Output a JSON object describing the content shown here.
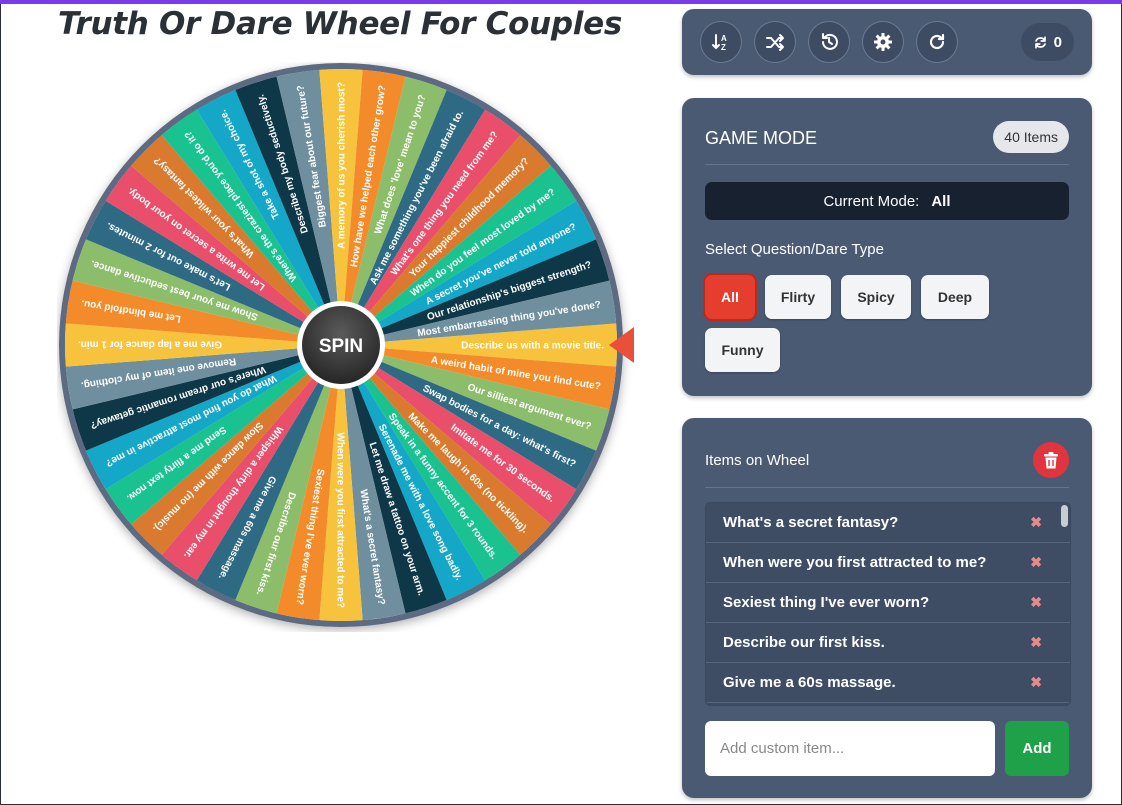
{
  "title": "Truth Or Dare Wheel For Couples",
  "spin_label": "SPIN",
  "toolbar": {
    "buttons": [
      {
        "icon": "sort-icon"
      },
      {
        "icon": "shuffle-icon"
      },
      {
        "icon": "history-icon"
      },
      {
        "icon": "settings-icon"
      },
      {
        "icon": "reset-icon"
      }
    ],
    "counter": "0"
  },
  "mode": {
    "title": "GAME MODE",
    "items_badge": "40 Items",
    "current_label": "Current Mode:",
    "current_value": "All",
    "select_label": "Select Question/Dare Type",
    "options": [
      "All",
      "Flirty",
      "Spicy",
      "Deep",
      "Funny"
    ],
    "active": "All"
  },
  "items_panel": {
    "title": "Items on Wheel",
    "items": [
      "What's a secret fantasy?",
      "When were you first attracted to me?",
      "Sexiest thing I've ever worn?",
      "Describe our first kiss.",
      "Give me a 60s massage."
    ],
    "placeholder": "Add custom item...",
    "add_label": "Add"
  },
  "wheel": {
    "colors": [
      "#f7c33c",
      "#f38b2a",
      "#8cbd6a",
      "#2f6a84",
      "#e94e6b",
      "#d97a2e",
      "#19c28f",
      "#14a7c8",
      "#0e3747",
      "#6f8f9e"
    ],
    "segments": [
      "Describe us with a movie title.",
      "A weird habit of mine you find cute?",
      "Our silliest argument ever?",
      "Swap bodies for a day: what's first?",
      "Imitate me for 30 seconds.",
      "Make me laugh in 60s (no tickling).",
      "Speak in a funny accent for 3 rounds.",
      "Serenade me with a love song badly.",
      "Let me draw a tattoo on your arm.",
      "What's a secret fantasy?",
      "When were you first attracted to me?",
      "Sexiest thing I've ever worn?",
      "Describe our first kiss.",
      "Give me a 60s massage.",
      "Whisper a dirty thought in my ear.",
      "Slow dance with me (no music).",
      "Send me a flirty text now.",
      "What do you find most attractive in me?",
      "Where's our dream romantic getaway?",
      "Remove one item of my clothing.",
      "Give me a lap dance for 1 min.",
      "Let me blindfold you.",
      "Show me your best seductive dance.",
      "Let's make out for 2 minutes.",
      "Let me write a secret on your body.",
      "What's your wildest fantasy?",
      "Where's the craziest place you'd do it?",
      "Take a shot of my choice.",
      "Describe my body seductively.",
      "Biggest fear about our future?",
      "A memory of us you cherish most?",
      "How have we helped each other grow?",
      "What does 'love' mean to you?",
      "Ask me something you've been afraid to.",
      "What's one thing you need from me?",
      "Your happiest childhood memory?",
      "When do you feel most loved by me?",
      "A secret you've never told anyone?",
      "Our relationship's biggest strength?",
      "Most embarrassing thing you've done?"
    ]
  }
}
